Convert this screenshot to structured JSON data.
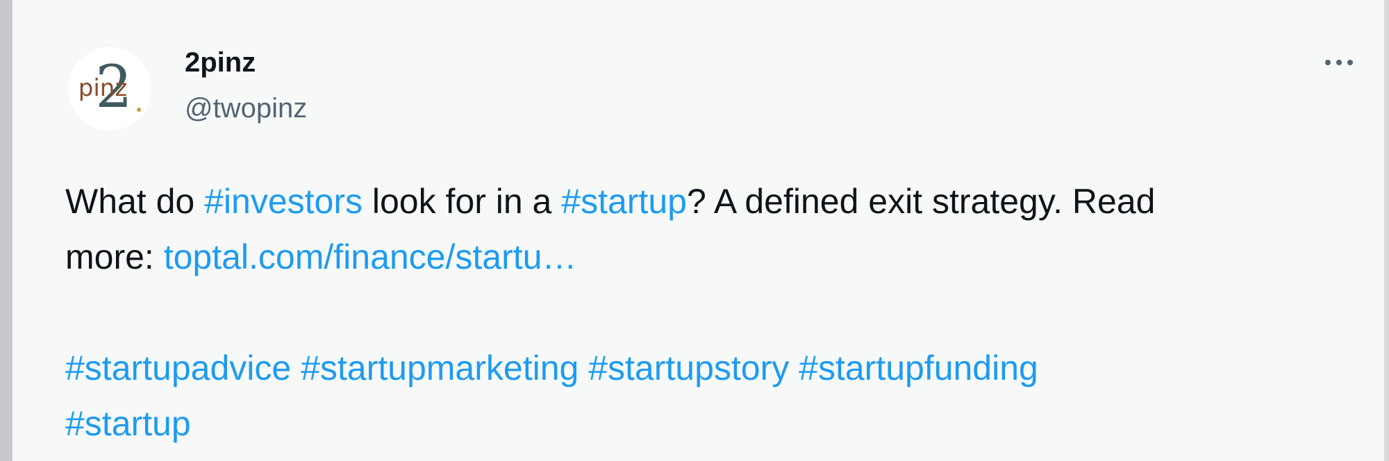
{
  "author": {
    "display_name": "2pinz",
    "handle": "@twopinz",
    "avatar_label": "pinz",
    "avatar_numeral": "2",
    "avatar_colors": {
      "numeral": "#3f5a60",
      "text": "#8a4a2a",
      "accent": "#c7a13a"
    }
  },
  "more_button": {
    "icon": "more-horizontal-icon"
  },
  "tweet": {
    "t1": "What do ",
    "tag_investors": "#investors",
    "t2": " look for in a ",
    "tag_startup_inline": "#startup",
    "t3": "? A defined exit strategy. Read",
    "t4": "more: ",
    "link": "toptal.com/finance/startu…",
    "tags_line1": [
      "#startupadvice",
      "#startupmarketing",
      "#startupstory",
      "#startupfunding"
    ],
    "tags_line2": [
      "#startup"
    ]
  },
  "colors": {
    "link": "#1d9bf0",
    "text": "#0f1419",
    "secondary": "#536471",
    "card_background": "#f7f9f9"
  }
}
